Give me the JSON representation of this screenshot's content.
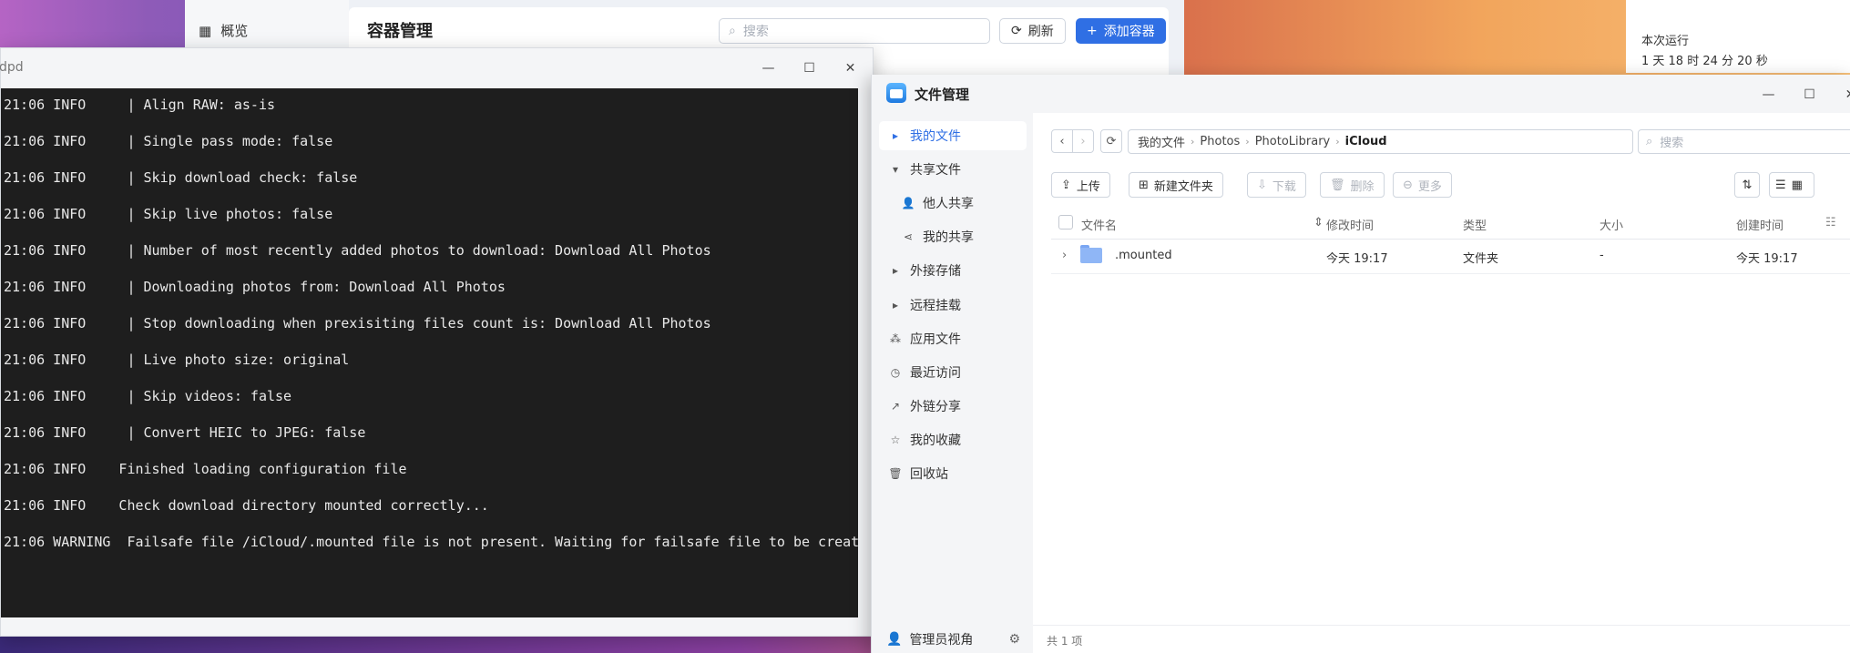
{
  "container_manager": {
    "nav_item": "概览",
    "title": "容器管理",
    "search_placeholder": "搜索",
    "refresh_label": "刷新",
    "add_label": "添加容器"
  },
  "uptime": {
    "label": "本次运行",
    "value": "1 天 18 时 24 分 20 秒"
  },
  "terminal": {
    "title_fragment": "dpd",
    "lines": [
      "21:06 INFO     | Align RAW: as-is",
      "21:06 INFO     | Single pass mode: false",
      "21:06 INFO     | Skip download check: false",
      "21:06 INFO     | Skip live photos: false",
      "21:06 INFO     | Number of most recently added photos to download: Download All Photos",
      "21:06 INFO     | Downloading photos from: Download All Photos",
      "21:06 INFO     | Stop downloading when prexisiting files count is: Download All Photos",
      "21:06 INFO     | Live photo size: original",
      "21:06 INFO     | Skip videos: false",
      "21:06 INFO     | Convert HEIC to JPEG: false",
      "21:06 INFO    Finished loading configuration file",
      "21:06 INFO    Check download directory mounted correctly...",
      "21:06 WARNING  Failsafe file /iCloud/.mounted file is not present. Waiting for failsafe file to be create"
    ]
  },
  "file_manager": {
    "title": "文件管理",
    "sidebar": [
      {
        "label": "我的文件",
        "icon": "caret-right-icon"
      },
      {
        "label": "共享文件",
        "icon": "caret-down-icon"
      },
      {
        "label": "他人共享",
        "icon": "users-icon"
      },
      {
        "label": "我的共享",
        "icon": "share-icon"
      },
      {
        "label": "外接存储",
        "icon": "caret-right-icon"
      },
      {
        "label": "远程挂载",
        "icon": "caret-right-icon"
      },
      {
        "label": "应用文件",
        "icon": "apps-icon"
      },
      {
        "label": "最近访问",
        "icon": "clock-icon"
      },
      {
        "label": "外链分享",
        "icon": "external-link-icon"
      },
      {
        "label": "我的收藏",
        "icon": "star-icon"
      },
      {
        "label": "回收站",
        "icon": "trash-icon"
      }
    ],
    "footer_label": "管理员视角",
    "path": [
      "我的文件",
      "Photos",
      "PhotoLibrary",
      "iCloud"
    ],
    "search_placeholder": "搜索",
    "toolbar": {
      "upload": "上传",
      "new_folder": "新建文件夹",
      "download": "下载",
      "delete": "删除",
      "more": "更多"
    },
    "columns": [
      "文件名",
      "修改时间",
      "类型",
      "大小",
      "创建时间"
    ],
    "rows": [
      {
        "name": ".mounted",
        "modified": "今天 19:17",
        "type": "文件夹",
        "size": "-",
        "created": "今天 19:17"
      }
    ],
    "status": "共 1 项"
  },
  "colors": {
    "accent": "#2f6fe4",
    "terminal_bg": "#1e1e1e"
  }
}
